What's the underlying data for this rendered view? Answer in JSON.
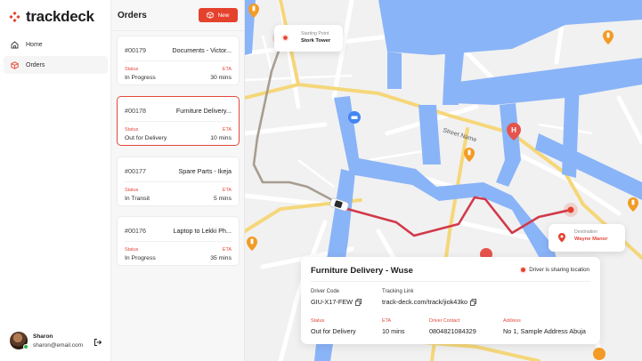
{
  "app": {
    "brand": "trackdeck"
  },
  "nav": [
    {
      "label": "Home",
      "icon": "home-icon"
    },
    {
      "label": "Orders",
      "icon": "box-icon"
    }
  ],
  "user": {
    "name": "Sharon",
    "email": "sharon@email.com"
  },
  "orders": {
    "title": "Orders",
    "new_label": "New",
    "status_label": "Status",
    "eta_label": "ETA",
    "items": [
      {
        "id": "#00179",
        "title": "Documents - Victor...",
        "status": "In Progress",
        "eta": "30 mins"
      },
      {
        "id": "#00178",
        "title": "Furniture Delivery...",
        "status": "Out for Delivery",
        "eta": "10 mins"
      },
      {
        "id": "#00177",
        "title": "Spare Parts - Ikeja",
        "status": "In Transit",
        "eta": "5 mins"
      },
      {
        "id": "#00176",
        "title": "Laptop to Lekki Ph...",
        "status": "In Progress",
        "eta": "35 mins"
      }
    ]
  },
  "map": {
    "start": {
      "label": "Starting Point",
      "value": "Stork Tower"
    },
    "destination": {
      "label": "Destination",
      "value": "Wayne Manor"
    },
    "street": "Street Name"
  },
  "details": {
    "title": "Furniture Delivery - Wuse",
    "sharing": "Driver is sharing location",
    "driver_code_label": "Driver Code",
    "driver_code": "GIU-X17-FEW",
    "tracking_label": "Tracking Link",
    "tracking_link": "track-deck.com/track/jiok43ko",
    "status_label": "Status",
    "status": "Out for Delivery",
    "eta_label": "ETA",
    "eta": "10 mins",
    "contact_label": "Driver Contact",
    "contact": "0804821084329",
    "address_label": "Address",
    "address": "No 1, Sample Address Abuja"
  },
  "colors": {
    "accent": "#e5422d",
    "water": "#8ab4f8",
    "route": "#d2394a",
    "road_yellow": "#f7db7a"
  }
}
